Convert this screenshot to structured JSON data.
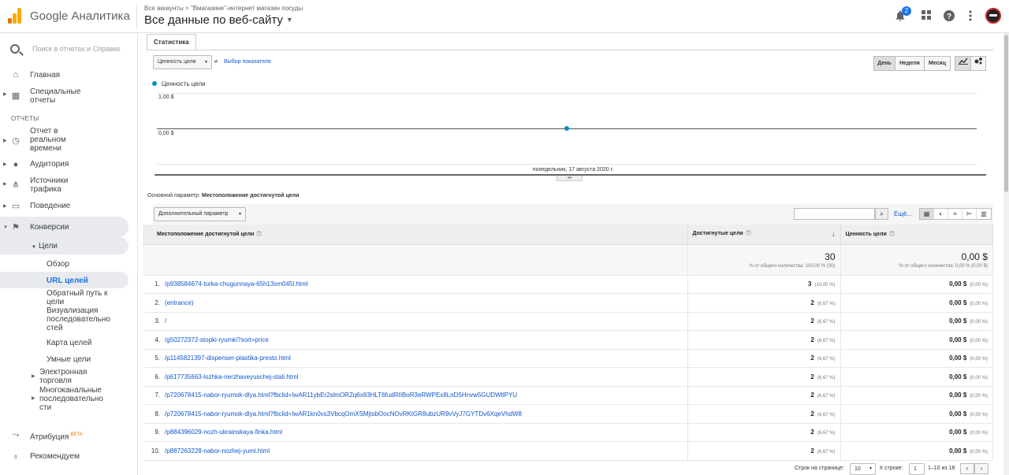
{
  "app": {
    "brand": "Google Аналитика"
  },
  "header": {
    "breadcrumb": "Все аккаунты > \"Вмагазине\"-интернет магазин посуды",
    "property": "Все данные по веб-сайту",
    "notifications_count": "2"
  },
  "sidebar": {
    "search_placeholder": "Поиск в отчетах и Справке",
    "home": "Главная",
    "custom": "Специальные\nотчеты",
    "reports_label": "ОТЧЕТЫ",
    "realtime": "Отчет в\nреальном\nвремени",
    "audience": "Аудитория",
    "acquisition": "Источники\nтрафика",
    "behavior": "Поведение",
    "conversions": "Конверсии",
    "goals": "Цели",
    "overview": "Обзор",
    "goal_urls": "URL целей",
    "reverse_path": "Обратный путь к\nцели",
    "funnel": "Визуализация\nпоследовательно\nстей",
    "flow": "Карта целей",
    "smart_goals": "Умные цели",
    "ecommerce": "Электронная\nторговля",
    "multichannel": "Многоканальные\nпоследовательно\nсти",
    "attribution": "Атрибуция",
    "beta": "BETA",
    "discover": "Рекомендуем"
  },
  "report": {
    "tab": "Статистика",
    "metric_select": "Ценность цели",
    "and": "и",
    "choose_metric": "Выбор показателя",
    "day": "День",
    "week": "Неделя",
    "month": "Месяц",
    "legend": "Ценность цели",
    "series_color": "#058dc7",
    "y_top": "1,00 $",
    "y_bottom": "0,00 $",
    "x_date": "понедельник, 17 августа 2020 г.",
    "primary_label": "Основной параметр:",
    "primary_value": "Местоположение достигнутой цели",
    "secondary": "Дополнительный параметр",
    "more": "Ещё..."
  },
  "chart_data": {
    "type": "line",
    "x": [
      "понедельник, 17 августа 2020 г."
    ],
    "series": [
      {
        "name": "Ценность цели",
        "values": [
          0
        ]
      }
    ],
    "ylim": [
      0,
      1
    ],
    "yticks": [
      "0,00 $",
      "1,00 $"
    ]
  },
  "table": {
    "col1": "Местоположение достигнутой цели",
    "col2": "Достигнутые цели",
    "col3": "Ценность цели",
    "total_goals": "30",
    "total_goals_pct": "% от общего количества: 100,00 % (30)",
    "total_value": "0,00 $",
    "total_value_pct": "% от общего количества: 0,00 % (0,00 $)",
    "rows": [
      {
        "n": "1.",
        "url": "/p938584674-turka-chugunnaya-65h13sm045l.html",
        "goals": "3",
        "gp": "(10,00 %)",
        "value": "0,00 $",
        "vp": "(0,00 %)"
      },
      {
        "n": "2.",
        "url": "(entrance)",
        "goals": "2",
        "gp": "(6,67 %)",
        "value": "0,00 $",
        "vp": "(0,00 %)"
      },
      {
        "n": "3.",
        "url": "/",
        "goals": "2",
        "gp": "(6,67 %)",
        "value": "0,00 $",
        "vp": "(0,00 %)"
      },
      {
        "n": "4.",
        "url": "/g50272372-stopki-ryumki?sort=price",
        "goals": "2",
        "gp": "(6,67 %)",
        "value": "0,00 $",
        "vp": "(0,00 %)"
      },
      {
        "n": "5.",
        "url": "/p1145821397-dispenser-plastika-presto.html",
        "goals": "2",
        "gp": "(6,67 %)",
        "value": "0,00 $",
        "vp": "(0,00 %)"
      },
      {
        "n": "6.",
        "url": "/p617735663-lozhka-nerzhaveyuschej-stali.html",
        "goals": "2",
        "gp": "(6,67 %)",
        "value": "0,00 $",
        "vp": "(0,00 %)"
      },
      {
        "n": "7.",
        "url": "/p720678415-nabor-ryumok-dlya.html?fbclid=IwAR11ybEr2slmORZq6x83HLT6fudRIIBoR3eRWPEx8LnD5Hnvw5GUDWtlPYU",
        "goals": "2",
        "gp": "(6,67 %)",
        "value": "0,00 $",
        "vp": "(0,00 %)"
      },
      {
        "n": "8.",
        "url": "/p720678415-nabor-ryumok-dlya.html?fbclid=IwAR1kn0vs3VbcqOmXSMjtsbOocNOvRKtGR8ubzUR9vVyJ7GYTDv6XqeVhdW8",
        "goals": "2",
        "gp": "(6,67 %)",
        "value": "0,00 $",
        "vp": "(0,00 %)"
      },
      {
        "n": "9.",
        "url": "/p884396029-nozh-ukrainskaya-finka.html",
        "goals": "2",
        "gp": "(6,67 %)",
        "value": "0,00 $",
        "vp": "(0,00 %)"
      },
      {
        "n": "10.",
        "url": "/p887263228-nabor-nozhej-yumi.html",
        "goals": "2",
        "gp": "(6,67 %)",
        "value": "0,00 $",
        "vp": "(0,00 %)"
      }
    ]
  },
  "footer": {
    "rows_label": "Строк на странице:",
    "rows_value": "10",
    "goto_label": "К строке:",
    "goto_value": "1",
    "range": "1–10 из 18"
  }
}
